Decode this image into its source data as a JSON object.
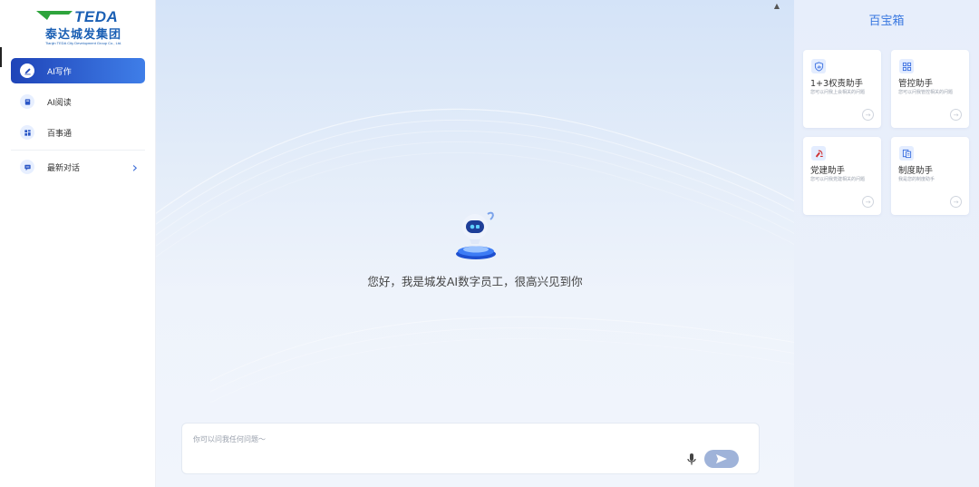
{
  "brand": {
    "mark": "TEDA",
    "name_cn": "泰达城发集团",
    "name_en": "Tianjin TEDA City Development Group Co., Ltd."
  },
  "sidebar": {
    "items": [
      {
        "label": "AI写作",
        "icon": "pen-icon",
        "active": true
      },
      {
        "label": "AI阅读",
        "icon": "book-icon",
        "active": false
      },
      {
        "label": "百事通",
        "icon": "grid-icon",
        "active": false
      }
    ],
    "recent": {
      "label": "最新对话",
      "icon": "chat-icon",
      "chevron": "›"
    }
  },
  "main": {
    "greeting": "您好，我是城发AI数字员工，很高兴见到你",
    "input_placeholder": "你可以问我任何问题～",
    "collapse_caret": "▲"
  },
  "toolbox": {
    "title": "百宝箱",
    "cards": [
      {
        "title": "1+3权责助手",
        "desc": "您可以问我上会相关的问题",
        "icon": "shield-chart-icon"
      },
      {
        "title": "管控助手",
        "desc": "您可以问我管控相关的问题",
        "icon": "grid-apps-icon"
      },
      {
        "title": "党建助手",
        "desc": "您可以问我党建相关的问题",
        "icon": "party-emblem-icon"
      },
      {
        "title": "制度助手",
        "desc": "我是您的制度助手",
        "icon": "document-icon"
      }
    ]
  },
  "colors": {
    "accent": "#2f64d8",
    "active_nav_start": "#1f44b8",
    "active_nav_end": "#3f7ee8",
    "title_blue": "#3a78e0",
    "send_button": "#9fb3d9"
  }
}
